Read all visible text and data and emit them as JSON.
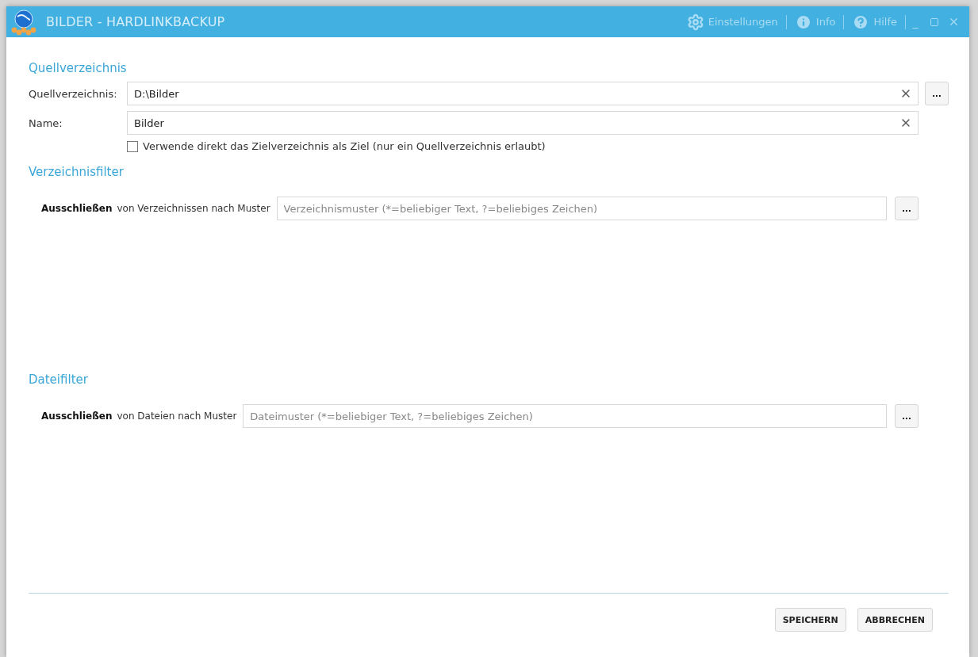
{
  "window": {
    "title": "BILDER - HARDLINKBACKUP",
    "menu": [
      {
        "kind": "gear",
        "label": "Einstellungen"
      },
      {
        "kind": "info",
        "label": "Info"
      },
      {
        "kind": "help",
        "label": "Hilfe"
      }
    ],
    "controls": [
      {
        "kind": "minimize",
        "label": "_"
      },
      {
        "kind": "maximize"
      },
      {
        "kind": "close"
      }
    ]
  },
  "source": {
    "title": "Quellverzeichnis",
    "fields": [
      {
        "label": "Quellverzeichnis:",
        "value": "D:\\Bilder",
        "browse": "..."
      },
      {
        "label": "Name:",
        "value": "Bilder"
      }
    ],
    "checkbox": {
      "label": "Verwende direkt das Zielverzeichnis als Ziel (nur ein Quellverzeichnis erlaubt)",
      "checked": false
    }
  },
  "filters": [
    {
      "title": "Verzeichnisfilter",
      "bold": "Ausschließen",
      "text": "von Verzeichnissen nach Muster",
      "placeholder": "Verzeichnismuster (*=beliebiger Text, ?=beliebiges Zeichen)",
      "browse": "..."
    },
    {
      "title": "Dateifilter",
      "bold": "Ausschließen",
      "text": "von Dateien nach Muster",
      "placeholder": "Dateimuster (*=beliebiger Text, ?=beliebiges Zeichen)",
      "browse": "..."
    }
  ],
  "buttons": [
    "SPEICHERN",
    "ABBRECHEN"
  ]
}
